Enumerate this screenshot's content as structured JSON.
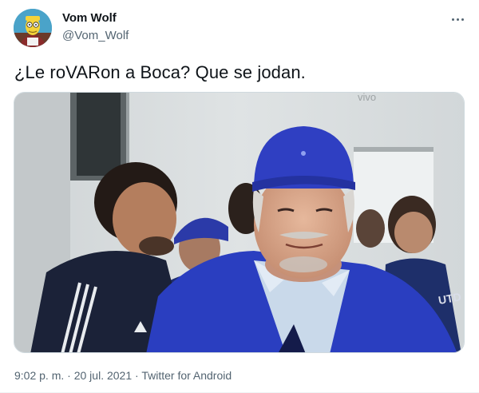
{
  "author": {
    "display_name": "Vom Wolf",
    "handle": "@Vom_Wolf",
    "avatar_icon": "cartoon-character-avatar"
  },
  "tweet": {
    "text": "¿Le roVARon a Boca? Que se jodan.",
    "time": "9:02 p. m.",
    "date": "20 jul. 2021",
    "source": "Twitter for Android",
    "separator": "·"
  },
  "media": {
    "kind": "photo",
    "overlay_text": "vivo",
    "jacket_logo_text": "UTD"
  },
  "colors": {
    "text_primary": "#0f1419",
    "text_secondary": "#536471",
    "border": "#cfd9de",
    "cap_blue": "#2f3fc2",
    "jacket_blue": "#2a3ec0"
  }
}
